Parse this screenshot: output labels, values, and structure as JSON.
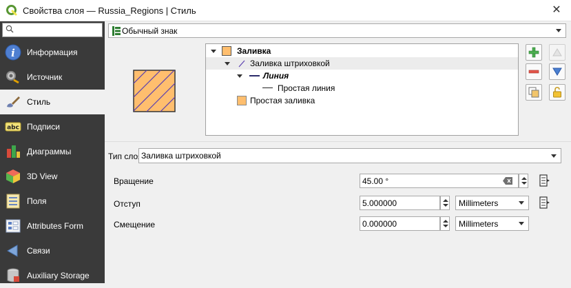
{
  "window": {
    "title": "Свойства слоя — Russia_Regions | Стиль"
  },
  "sidebar": {
    "search_placeholder": "",
    "items": [
      {
        "label": "Информация",
        "icon": "info-icon"
      },
      {
        "label": "Источник",
        "icon": "source-icon"
      },
      {
        "label": "Стиль",
        "icon": "brush-icon",
        "active": true
      },
      {
        "label": "Подписи",
        "icon": "labels-abc-icon"
      },
      {
        "label": "Диаграммы",
        "icon": "diagram-icon"
      },
      {
        "label": "3D View",
        "icon": "cube-3d-icon"
      },
      {
        "label": "Поля",
        "icon": "fields-icon"
      },
      {
        "label": "Attributes Form",
        "icon": "form-icon"
      },
      {
        "label": "Связи",
        "icon": "relations-icon"
      },
      {
        "label": "Auxiliary Storage",
        "icon": "database-icon"
      }
    ]
  },
  "renderer": {
    "selected": "Обычный знак"
  },
  "symbol_tree": {
    "rows": [
      {
        "label": "Заливка",
        "style": "bold"
      },
      {
        "label": "Заливка штриховкой",
        "style": "normal"
      },
      {
        "label": "Линия",
        "style": "bold-italic"
      },
      {
        "label": "Простая линия",
        "style": "normal"
      },
      {
        "label": "Простая заливка",
        "style": "normal"
      }
    ]
  },
  "layer_type": {
    "label": "Тип слоя",
    "selected": "Заливка штриховкой"
  },
  "properties": {
    "rotation": {
      "label": "Вращение",
      "value": "45.00 °"
    },
    "spacing": {
      "label": "Отступ",
      "value": "5.000000",
      "unit": "Millimeters"
    },
    "offset": {
      "label": "Смещение",
      "value": "0.000000",
      "unit": "Millimeters"
    }
  },
  "colors": {
    "fill": "#ffbe6e",
    "hatch": "#5a3fb0",
    "sidebar_bg": "#3a3a3a",
    "qgis_green": "#589632"
  }
}
